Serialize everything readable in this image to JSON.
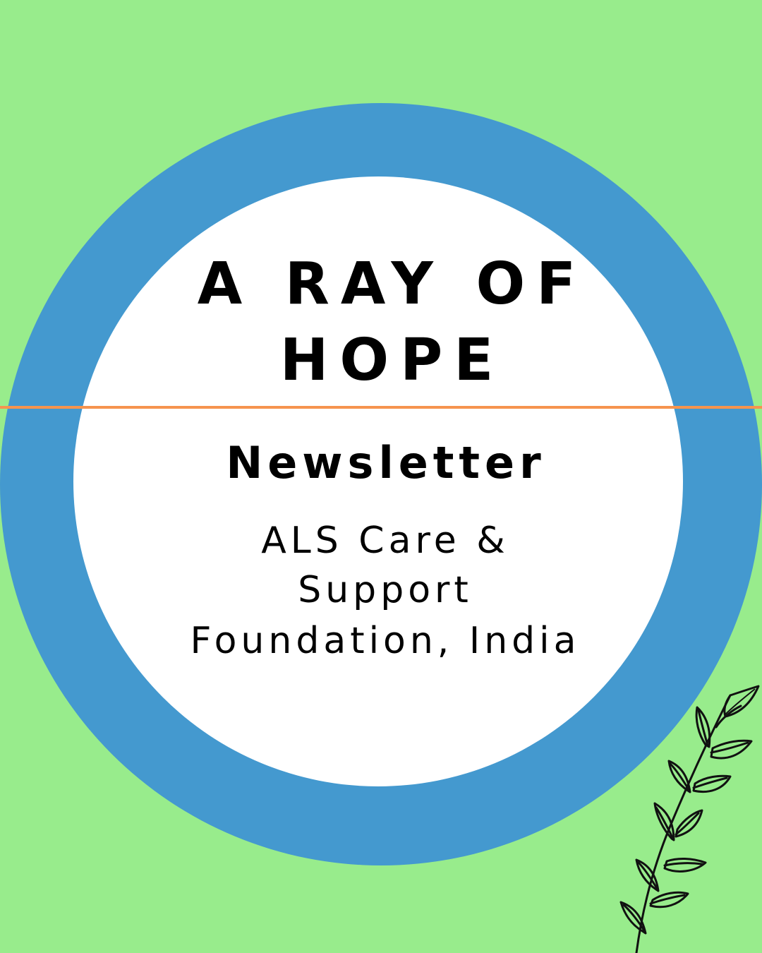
{
  "cover": {
    "title_line1": "A RAY OF",
    "title_line2": "HOPE",
    "subtitle": "Newsletter",
    "org_line1": "ALS Care &",
    "org_line2": "Support",
    "org_line3": "Foundation, India"
  },
  "colors": {
    "background": "#98ec8c",
    "ring": "#4499cf",
    "inner": "#ffffff",
    "divider": "#f6944e",
    "text": "#000000"
  },
  "decor": {
    "icon": "leaf-branch-icon"
  }
}
